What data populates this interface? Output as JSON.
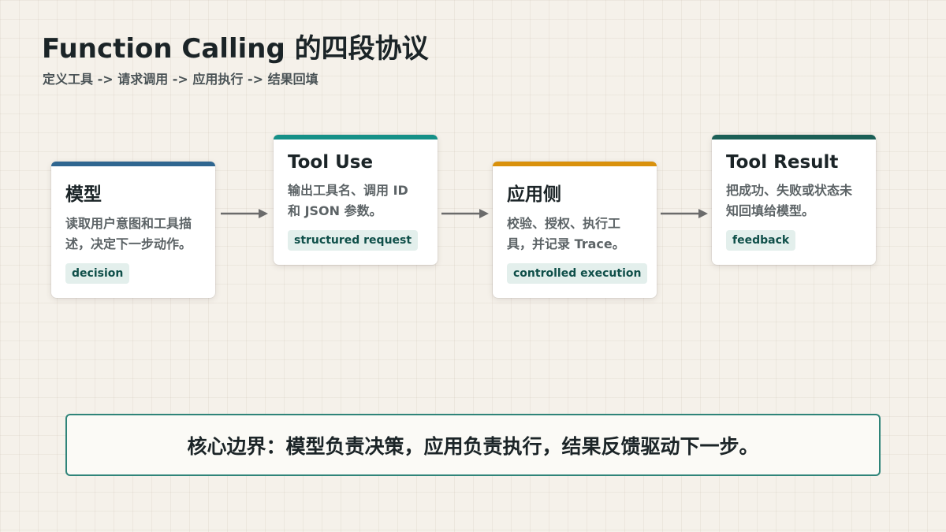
{
  "title": "Function Calling 的四段协议",
  "subtitle": "定义工具 -> 请求调用 -> 应用执行 -> 结果回填",
  "colors": {
    "model": "#2f6690",
    "tool_use": "#159087",
    "app_side": "#d9910c",
    "tool_result": "#1b5f56",
    "arrow": "#6b6b6b"
  },
  "steps": [
    {
      "title": "模型",
      "desc": "读取用户意图和工具描述，决定下一步动作。",
      "tag": "decision"
    },
    {
      "title": "Tool Use",
      "desc": "输出工具名、调用 ID 和 JSON 参数。",
      "tag": "structured request"
    },
    {
      "title": "应用侧",
      "desc": "校验、授权、执行工具，并记录 Trace。",
      "tag": "controlled execution"
    },
    {
      "title": "Tool Result",
      "desc": "把成功、失败或状态未知回填给模型。",
      "tag": "feedback"
    }
  ],
  "summary": "核心边界：模型负责决策，应用负责执行，结果反馈驱动下一步。"
}
